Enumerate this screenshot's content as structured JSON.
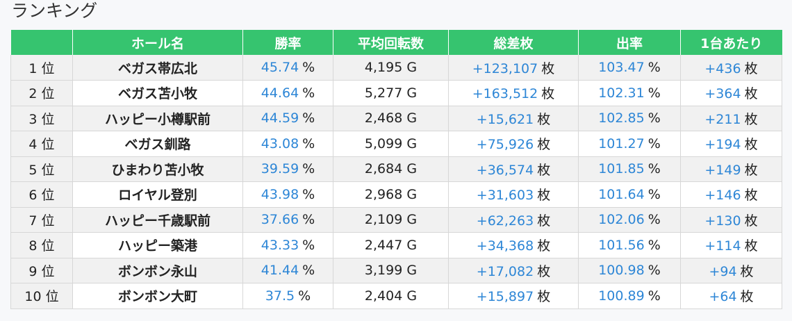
{
  "title": "ランキング",
  "colors": {
    "header_bg": "#36c46f",
    "value_blue": "#2d86d6"
  },
  "columns": [
    "",
    "ホール名",
    "勝率",
    "平均回転数",
    "総差枚",
    "出率",
    "1台あたり"
  ],
  "rows": [
    {
      "rank": "1 位",
      "hall": "ベガス帯広北",
      "win": "45.74",
      "win_unit": "%",
      "spins": "4,195 G",
      "total": "+123,107",
      "total_unit": "枚",
      "payout": "103.47",
      "payout_unit": "%",
      "per": "+436",
      "per_unit": "枚"
    },
    {
      "rank": "2 位",
      "hall": "ベガス苫小牧",
      "win": "44.64",
      "win_unit": "%",
      "spins": "5,277 G",
      "total": "+163,512",
      "total_unit": "枚",
      "payout": "102.31",
      "payout_unit": "%",
      "per": "+364",
      "per_unit": "枚"
    },
    {
      "rank": "3 位",
      "hall": "ハッピー小樽駅前",
      "win": "44.59",
      "win_unit": "%",
      "spins": "2,468 G",
      "total": "+15,621",
      "total_unit": "枚",
      "payout": "102.85",
      "payout_unit": "%",
      "per": "+211",
      "per_unit": "枚"
    },
    {
      "rank": "4 位",
      "hall": "ベガス釧路",
      "win": "43.08",
      "win_unit": "%",
      "spins": "5,099 G",
      "total": "+75,926",
      "total_unit": "枚",
      "payout": "101.27",
      "payout_unit": "%",
      "per": "+194",
      "per_unit": "枚"
    },
    {
      "rank": "5 位",
      "hall": "ひまわり苫小牧",
      "win": "39.59",
      "win_unit": "%",
      "spins": "2,684 G",
      "total": "+36,574",
      "total_unit": "枚",
      "payout": "101.85",
      "payout_unit": "%",
      "per": "+149",
      "per_unit": "枚"
    },
    {
      "rank": "6 位",
      "hall": "ロイヤル登別",
      "win": "43.98",
      "win_unit": "%",
      "spins": "2,968 G",
      "total": "+31,603",
      "total_unit": "枚",
      "payout": "101.64",
      "payout_unit": "%",
      "per": "+146",
      "per_unit": "枚"
    },
    {
      "rank": "7 位",
      "hall": "ハッピー千歳駅前",
      "win": "37.66",
      "win_unit": "%",
      "spins": "2,109 G",
      "total": "+62,263",
      "total_unit": "枚",
      "payout": "102.06",
      "payout_unit": "%",
      "per": "+130",
      "per_unit": "枚"
    },
    {
      "rank": "8 位",
      "hall": "ハッピー築港",
      "win": "43.33",
      "win_unit": "%",
      "spins": "2,447 G",
      "total": "+34,368",
      "total_unit": "枚",
      "payout": "101.56",
      "payout_unit": "%",
      "per": "+114",
      "per_unit": "枚"
    },
    {
      "rank": "9 位",
      "hall": "ボンボン永山",
      "win": "41.44",
      "win_unit": "%",
      "spins": "3,199 G",
      "total": "+17,082",
      "total_unit": "枚",
      "payout": "100.98",
      "payout_unit": "%",
      "per": "+94",
      "per_unit": "枚"
    },
    {
      "rank": "10 位",
      "hall": "ボンボン大町",
      "win": "37.5",
      "win_unit": "%",
      "spins": "2,404 G",
      "total": "+15,897",
      "total_unit": "枚",
      "payout": "100.89",
      "payout_unit": "%",
      "per": "+64",
      "per_unit": "枚"
    }
  ]
}
